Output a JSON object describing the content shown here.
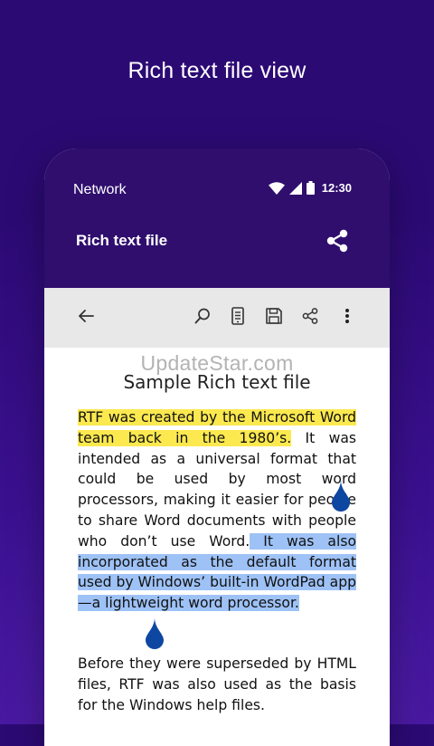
{
  "headline": "Rich text file view",
  "status_bar": {
    "carrier": "Network",
    "time": "12:30"
  },
  "app_bar": {
    "title": "Rich text file"
  },
  "toolbar": {
    "buttons": [
      "back-arrow-icon",
      "search-icon",
      "reading-mode-icon",
      "save-icon",
      "share-icon",
      "more-vert-icon"
    ]
  },
  "document": {
    "watermark": "UpdateStar.com",
    "title": "Sample Rich text file",
    "paragraph1": {
      "highlight_yellow": "RTF was created by the Microsoft Word team back in the 1980’s.",
      "plain": " It was intended as a universal format that could be used by most word processors, making it easier for people to share Word documents with people who don’t use Word.",
      "selected": " It was also incorporated as the default format used by Windows’ built-in WordPad app—a lightweight word processor."
    },
    "paragraph2": "Before they were superseded by HTML files, RTF was also used as the basis for the Windows help files."
  },
  "colors": {
    "background": "#3b1090",
    "app_bar": "#2f0e6e",
    "toolbar": "#e8e8e8",
    "highlight_yellow": "#fce94f",
    "selection_blue": "#9ec2f6",
    "selection_handle": "#0d47a1"
  }
}
